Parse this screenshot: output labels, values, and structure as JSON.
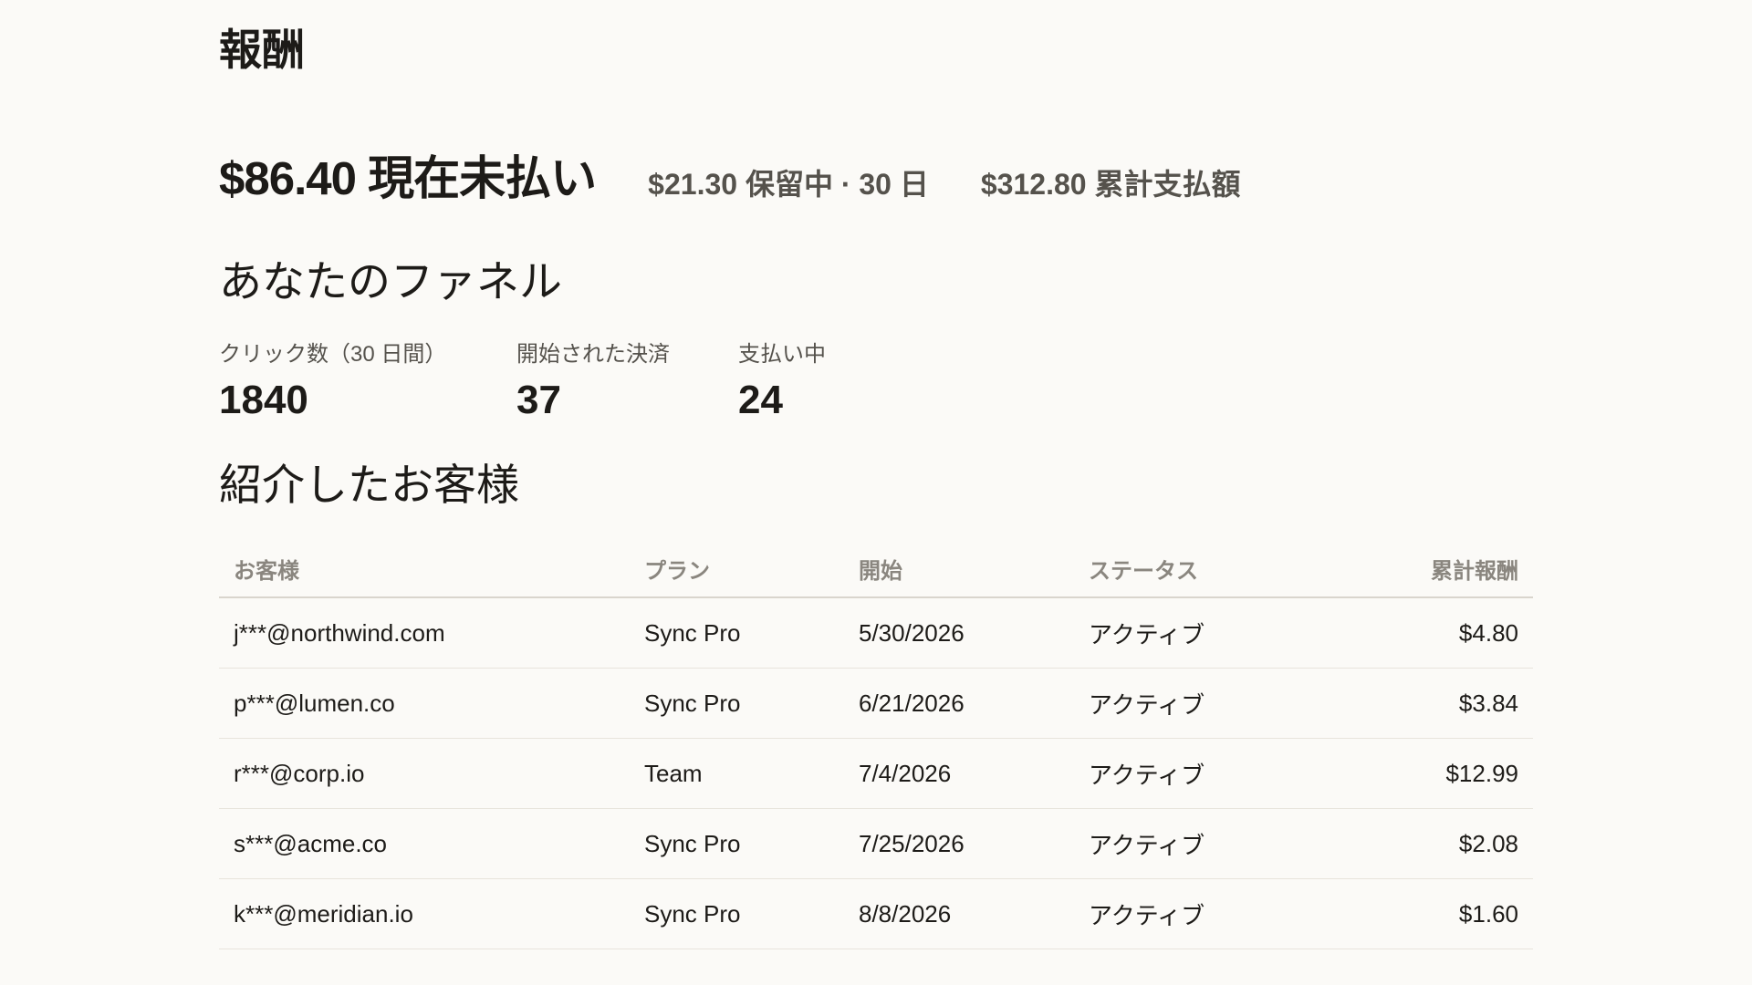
{
  "page": {
    "title": "報酬"
  },
  "balances": {
    "main": "$86.40 現在未払い",
    "pending": "$21.30 保留中 · 30 日",
    "total_paid": "$312.80 累計支払額"
  },
  "funnel": {
    "title": "あなたのファネル",
    "items": [
      {
        "label": "クリック数（30 日間）",
        "value": "1840"
      },
      {
        "label": "開始された決済",
        "value": "37"
      },
      {
        "label": "支払い中",
        "value": "24"
      }
    ]
  },
  "customers": {
    "title": "紹介したお客様",
    "columns": [
      "お客様",
      "プラン",
      "開始",
      "ステータス",
      "累計報酬"
    ],
    "rows": [
      [
        "j***@northwind.com",
        "Sync Pro",
        "5/30/2026",
        "アクティブ",
        "$4.80"
      ],
      [
        "p***@lumen.co",
        "Sync Pro",
        "6/21/2026",
        "アクティブ",
        "$3.84"
      ],
      [
        "r***@corp.io",
        "Team",
        "7/4/2026",
        "アクティブ",
        "$12.99"
      ],
      [
        "s***@acme.co",
        "Sync Pro",
        "7/25/2026",
        "アクティブ",
        "$2.08"
      ],
      [
        "k***@meridian.io",
        "Sync Pro",
        "8/8/2026",
        "アクティブ",
        "$1.60"
      ]
    ]
  },
  "colors": {
    "background": "#fbfaf7",
    "text": "#1d1b18",
    "muted": "#55524c",
    "header": "#8a867f"
  }
}
